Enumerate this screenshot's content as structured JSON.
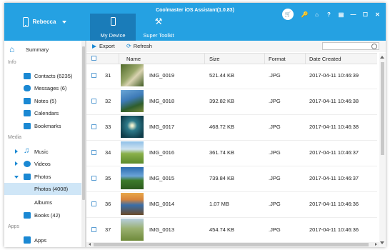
{
  "window": {
    "title": "Coolmaster iOS Assistant(1.0.83)"
  },
  "device": {
    "name": "Rebecca"
  },
  "tabs": [
    {
      "label": "My Device",
      "icon": "phone-icon",
      "active": true
    },
    {
      "label": "Super Toolkit",
      "icon": "wrench-icon",
      "active": false
    }
  ],
  "window_controls": [
    "store-icon",
    "key-icon",
    "home-icon",
    "help-icon",
    "feedback-icon",
    "minimize-icon",
    "maximize-icon",
    "close-icon"
  ],
  "sidebar": {
    "summary": "Summary",
    "sections": {
      "info": "Info",
      "media": "Media",
      "apps": "Apps"
    },
    "contacts": "Contacts  (6235)",
    "messages": "Messages  (6)",
    "notes": "Notes  (5)",
    "calendars": "Calendars",
    "bookmarks": "Bookmarks",
    "music": "Music",
    "videos": "Videos",
    "photos": "Photos",
    "photos_sub": "Photos  (4008)",
    "albums": "Albums",
    "books": "Books  (42)",
    "apps_item": "Apps"
  },
  "toolbar": {
    "export": "Export",
    "refresh": "Refresh",
    "search_placeholder": ""
  },
  "table": {
    "columns": {
      "name": "Name",
      "size": "Size",
      "format": "Format",
      "date": "Date Created"
    },
    "rows": [
      {
        "num": "31",
        "name": "IMG_0019",
        "size": "521.44 KB",
        "format": ".JPG",
        "date": "2017-04-11 10:46:39"
      },
      {
        "num": "32",
        "name": "IMG_0018",
        "size": "392.82 KB",
        "format": ".JPG",
        "date": "2017-04-11 10:46:38"
      },
      {
        "num": "33",
        "name": "IMG_0017",
        "size": "468.72 KB",
        "format": ".JPG",
        "date": "2017-04-11 10:46:38"
      },
      {
        "num": "34",
        "name": "IMG_0016",
        "size": "361.74 KB",
        "format": ".JPG",
        "date": "2017-04-11 10:46:37"
      },
      {
        "num": "35",
        "name": "IMG_0015",
        "size": "739.84 KB",
        "format": ".JPG",
        "date": "2017-04-11 10:46:37"
      },
      {
        "num": "36",
        "name": "IMG_0014",
        "size": "1.07 MB",
        "format": ".JPG",
        "date": "2017-04-11 10:46:36"
      },
      {
        "num": "37",
        "name": "IMG_0013",
        "size": "454.74 KB",
        "format": ".JPG",
        "date": "2017-04-11 10:46:36"
      }
    ]
  },
  "colors": {
    "accent": "#25a1e2",
    "active_tab": "#1a7cb9",
    "selected_item": "#cfe6f7",
    "icon_blue": "#1a88d3"
  }
}
